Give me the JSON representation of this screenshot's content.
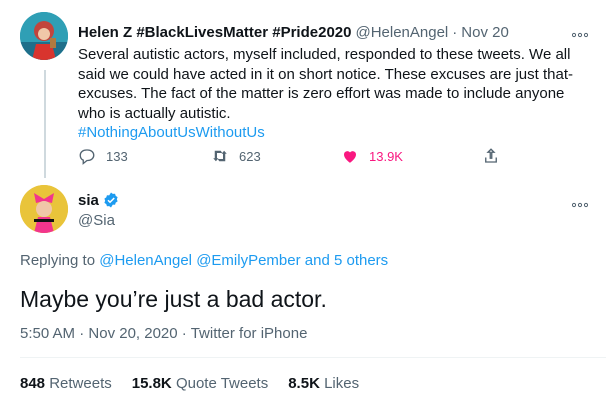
{
  "reply_tweet": {
    "display_name": "Helen Z #BlackLivesMatter #Pride2020",
    "handle": "@HelenAngel",
    "separator": "·",
    "date": "Nov 20",
    "more_icon": "more-icon",
    "text": "Several autistic actors, myself included, responded to these tweets. We all said we could have acted in it on short notice. These excuses are just that- excuses. The fact of the matter is zero effort was made to include anyone who is actually autistic.",
    "hashtag": "#NothingAboutUsWithoutUs",
    "actions": {
      "replies": "133",
      "retweets": "623",
      "likes": "13.9K"
    }
  },
  "main_tweet": {
    "display_name": "sia",
    "handle": "@Sia",
    "replying_prefix": "Replying to",
    "replying_to_1": "@HelenAngel",
    "replying_to_2": "@EmilyPember",
    "replying_others": "and 5 others",
    "text": "Maybe you’re just a bad actor.",
    "time": "5:50 AM",
    "separator": "·",
    "date": "Nov 20, 2020",
    "source": "Twitter for iPhone",
    "stats": {
      "retweets_count": "848",
      "retweets_label": "Retweets",
      "quotes_count": "15.8K",
      "quotes_label": "Quote Tweets",
      "likes_count": "8.5K",
      "likes_label": "Likes"
    }
  },
  "colors": {
    "link": "#1d9bf0",
    "like": "#f91880",
    "secondary_text": "#536471",
    "primary_text": "#0f1419"
  }
}
